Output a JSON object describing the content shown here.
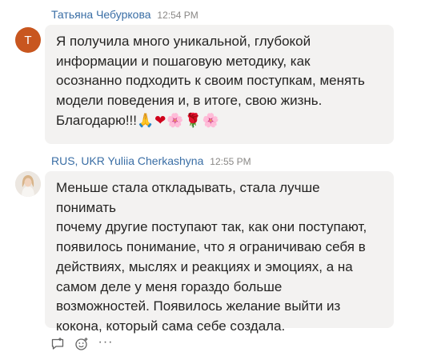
{
  "messages": [
    {
      "avatar_letter": "Т",
      "author": "Татьяна Чебуркова",
      "time": "12:54 PM",
      "text": "Я получила много уникальной, глубокой\nинформации и пошаговую методику, как\nосознанно подходить к своим поступкам, менять\nмодели поведения и, в итоге, свою жизнь.\nБлагодарю!!!",
      "emojis": [
        "🙏",
        "❤",
        "🌸",
        "🌹",
        "🌸"
      ]
    },
    {
      "author": "RUS, UKR Yuliia Cherkashyna",
      "time": "12:55 PM",
      "text": "Меньше стала откладывать, стала лучше понимать\nпочему другие поступают так, как они поступают,\nпоявилось понимание, что я ограничиваю себя в\nдействиях, мыслях и реакциях и эмоциях, а на\nсамом деле у меня гораздо больше\nвозможностей. Появилось желание выйти из\nкокона, который сама себе создала."
    }
  ],
  "actions": {
    "more_label": "···"
  },
  "colors": {
    "author": "#3a6ea5",
    "bubble": "#f3f2f1",
    "avatar_letter_bg": "#c8561f",
    "timestamp": "#8a8886"
  },
  "icons": [
    "reply-icon",
    "emoji-reaction-icon",
    "more-options-icon"
  ]
}
